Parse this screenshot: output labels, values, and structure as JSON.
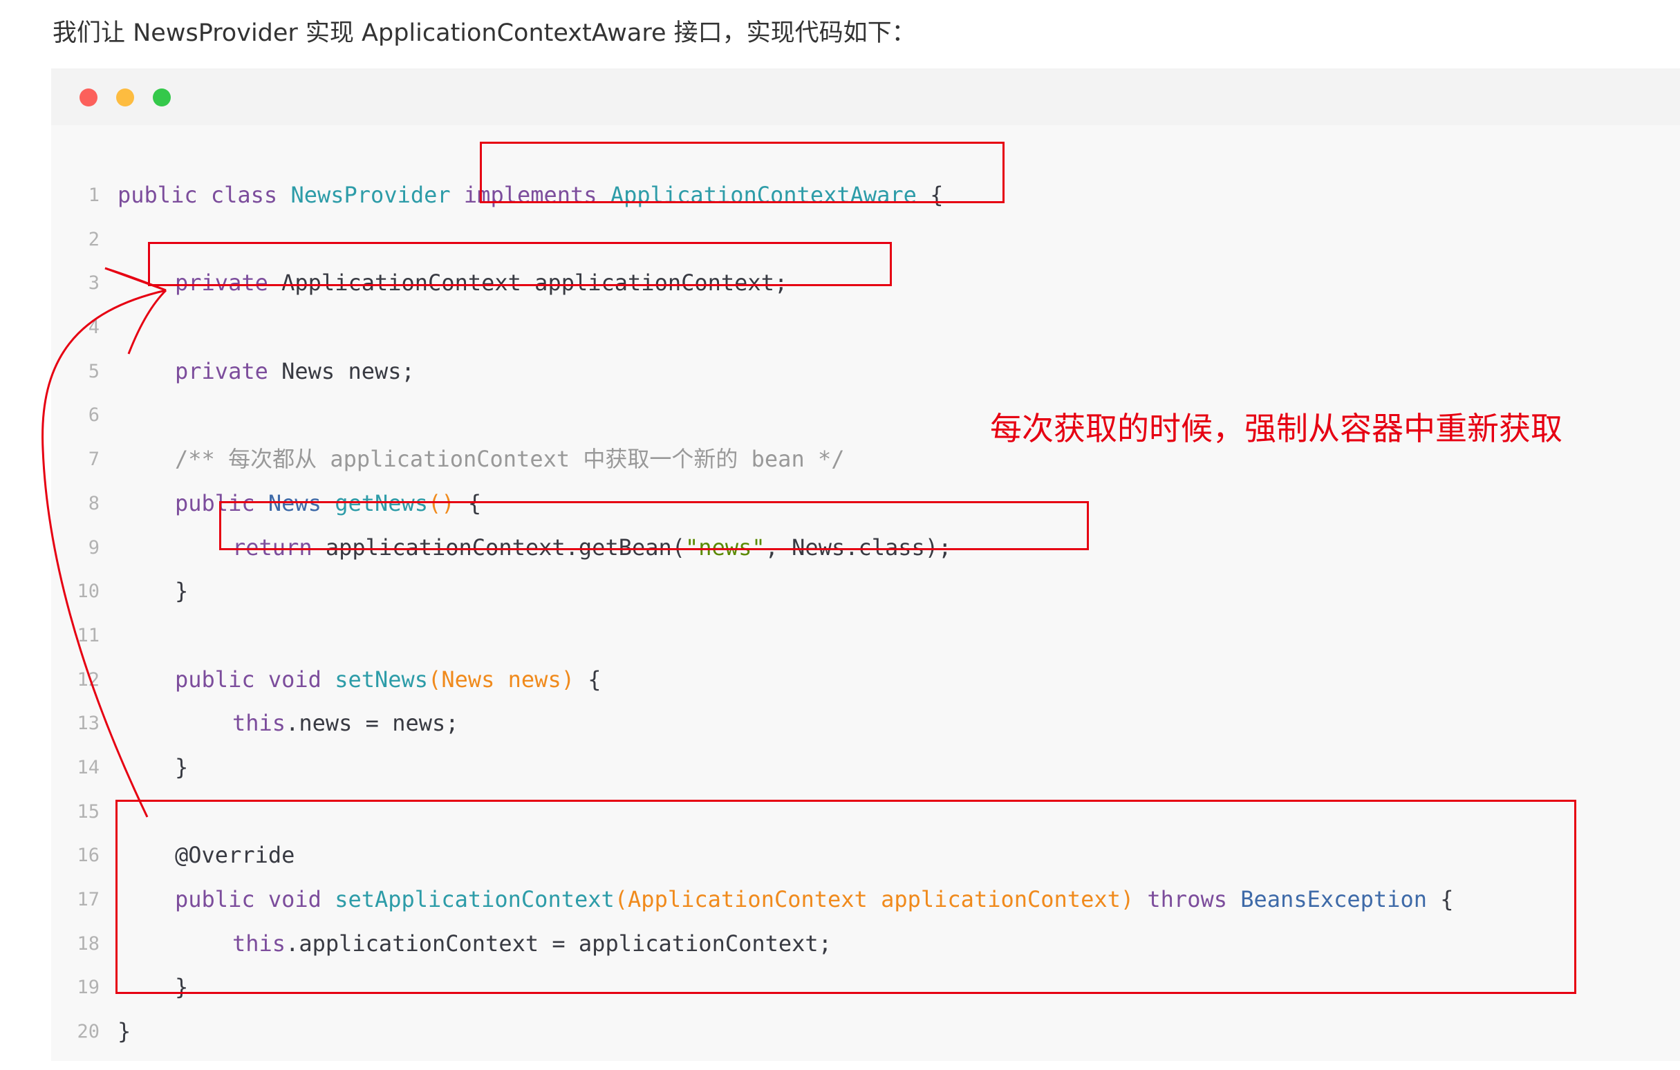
{
  "intro_text": "我们让 NewsProvider 实现 ApplicationContextAware 接口，实现代码如下：",
  "window_controls": [
    "close",
    "minimize",
    "maximize"
  ],
  "code_lines": [
    {
      "n": "1",
      "indent": 0,
      "tokens": [
        [
          "kw",
          "public"
        ],
        [
          "pl",
          " "
        ],
        [
          "kw",
          "class"
        ],
        [
          "pl",
          " "
        ],
        [
          "cls",
          "NewsProvider"
        ],
        [
          "pl",
          " "
        ],
        [
          "kw",
          "implements"
        ],
        [
          "pl",
          " "
        ],
        [
          "cls",
          "ApplicationContextAware"
        ],
        [
          "pl",
          " {"
        ]
      ]
    },
    {
      "n": "2",
      "indent": 0,
      "tokens": []
    },
    {
      "n": "3",
      "indent": 1,
      "tokens": [
        [
          "kw",
          "private"
        ],
        [
          "pl",
          " ApplicationContext applicationContext;"
        ]
      ]
    },
    {
      "n": "4",
      "indent": 0,
      "tokens": []
    },
    {
      "n": "5",
      "indent": 1,
      "tokens": [
        [
          "kw",
          "private"
        ],
        [
          "pl",
          " News news;"
        ]
      ]
    },
    {
      "n": "6",
      "indent": 0,
      "tokens": []
    },
    {
      "n": "7",
      "indent": 1,
      "tokens": [
        [
          "cmt",
          "/** 每次都从 applicationContext 中获取一个新的 bean */"
        ]
      ]
    },
    {
      "n": "8",
      "indent": 1,
      "tokens": [
        [
          "kw",
          "public"
        ],
        [
          "pl",
          " "
        ],
        [
          "tname",
          "News"
        ],
        [
          "pl",
          " "
        ],
        [
          "fn",
          "getNews"
        ],
        [
          "param",
          "()"
        ],
        [
          "pl",
          " {"
        ]
      ]
    },
    {
      "n": "9",
      "indent": 2,
      "tokens": [
        [
          "kw",
          "return"
        ],
        [
          "pl",
          " applicationContext.getBean("
        ],
        [
          "str",
          "\"news\""
        ],
        [
          "pl",
          ", News.class);"
        ]
      ]
    },
    {
      "n": "10",
      "indent": 1,
      "tokens": [
        [
          "pl",
          "}"
        ]
      ]
    },
    {
      "n": "11",
      "indent": 0,
      "tokens": []
    },
    {
      "n": "12",
      "indent": 1,
      "tokens": [
        [
          "kw",
          "public"
        ],
        [
          "pl",
          " "
        ],
        [
          "kw",
          "void"
        ],
        [
          "pl",
          " "
        ],
        [
          "fn",
          "setNews"
        ],
        [
          "param",
          "(News news)"
        ],
        [
          "pl",
          " {"
        ]
      ]
    },
    {
      "n": "13",
      "indent": 2,
      "tokens": [
        [
          "kw",
          "this"
        ],
        [
          "pl",
          ".news = news;"
        ]
      ]
    },
    {
      "n": "14",
      "indent": 1,
      "tokens": [
        [
          "pl",
          "}"
        ]
      ]
    },
    {
      "n": "15",
      "indent": 0,
      "tokens": []
    },
    {
      "n": "16",
      "indent": 1,
      "tokens": [
        [
          "pl",
          "@Override"
        ]
      ]
    },
    {
      "n": "17",
      "indent": 1,
      "tokens": [
        [
          "kw",
          "public"
        ],
        [
          "pl",
          " "
        ],
        [
          "kw",
          "void"
        ],
        [
          "pl",
          " "
        ],
        [
          "fn",
          "setApplicationContext"
        ],
        [
          "param",
          "(ApplicationContext applicationContext)"
        ],
        [
          "pl",
          " "
        ],
        [
          "kw",
          "throws"
        ],
        [
          "pl",
          " "
        ],
        [
          "tname",
          "BeansException"
        ],
        [
          "pl",
          " {"
        ]
      ]
    },
    {
      "n": "18",
      "indent": 2,
      "tokens": [
        [
          "kw",
          "this"
        ],
        [
          "pl",
          ".applicationContext = applicationContext;"
        ]
      ]
    },
    {
      "n": "19",
      "indent": 1,
      "tokens": [
        [
          "pl",
          "}"
        ]
      ]
    },
    {
      "n": "20",
      "indent": 0,
      "tokens": [
        [
          "pl",
          "}"
        ]
      ]
    }
  ],
  "annotation_text": "每次获取的时候，强制从容器中重新获取",
  "colors": {
    "keyword": "#7c4d9c",
    "class_name": "#2d9ca8",
    "type_name": "#3e6aa8",
    "parameter": "#f08a1c",
    "string": "#5a8a00",
    "comment": "#999999",
    "annotation_red": "#e60012",
    "code_background": "#f8f8f8"
  }
}
